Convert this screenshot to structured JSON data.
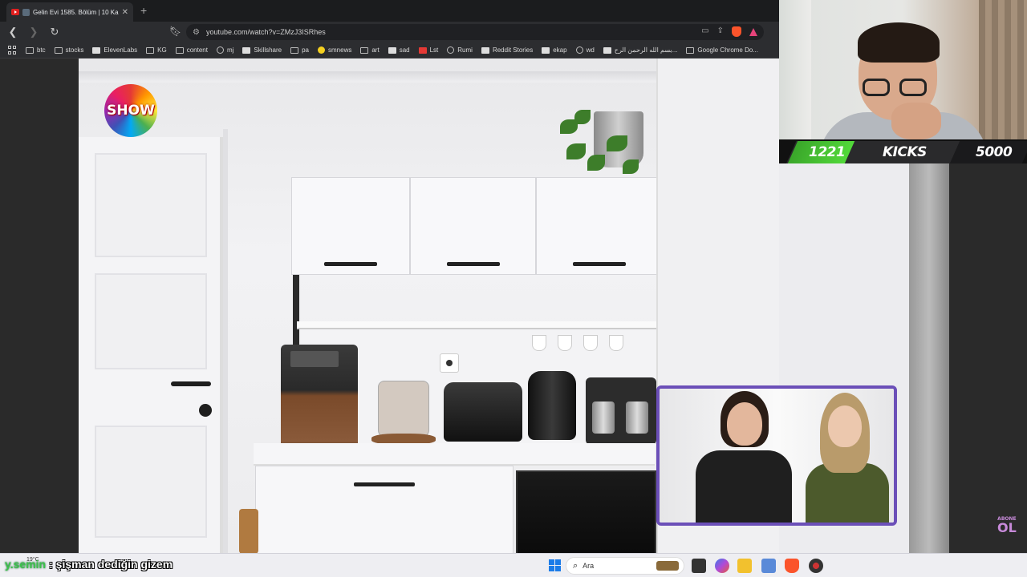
{
  "browser": {
    "tab_title": "Gelin Evi 1585. Bölüm | 10 Ka...",
    "tab_close": "✕",
    "new_tab": "+",
    "url": "youtube.com/watch?v=ZMzJ3ISRhes"
  },
  "bookmarks": [
    {
      "label": "btc",
      "icon": "folder-icon"
    },
    {
      "label": "stocks",
      "icon": "folder-icon"
    },
    {
      "label": "ElevenLabs",
      "icon": "elevenlabs-icon"
    },
    {
      "label": "KG",
      "icon": "folder-icon"
    },
    {
      "label": "content",
      "icon": "folder-icon"
    },
    {
      "label": "mj",
      "icon": "github-icon"
    },
    {
      "label": "Skillshare",
      "icon": "skillshare-icon"
    },
    {
      "label": "pa",
      "icon": "folder-icon"
    },
    {
      "label": "smnews",
      "icon": "smiley-icon"
    },
    {
      "label": "art",
      "icon": "folder-icon"
    },
    {
      "label": "sad",
      "icon": "slash-icon"
    },
    {
      "label": "Lst",
      "icon": "s-logo-icon"
    },
    {
      "label": "Rumi",
      "icon": "globe-icon"
    },
    {
      "label": "Reddit Stories",
      "icon": "d-logo-icon"
    },
    {
      "label": "ekap",
      "icon": "bird-icon"
    },
    {
      "label": "wd",
      "icon": "globe-icon"
    },
    {
      "label": "بسم الله الرحمن الرح...",
      "icon": "doc-icon"
    },
    {
      "label": "Google Chrome Do...",
      "icon": "folder-icon"
    }
  ],
  "video": {
    "channel_logo": "SHOW"
  },
  "overlay": {
    "kicks_count": "1221",
    "kicks_label": "KICKS",
    "kicks_goal": "5000",
    "kicks_progress": 0.244,
    "abone_top": "ABONE",
    "abone_bottom": "OL"
  },
  "taskbar": {
    "weather_temp": "19°C",
    "chat_user": "y.semin",
    "chat_message": ": şişman dediğin gizem",
    "search_placeholder": "Ara"
  },
  "colors": {
    "accent_purple": "#6b4fb8",
    "kicks_green": "#52d93a",
    "windows_blue": "#1c7ce8"
  }
}
